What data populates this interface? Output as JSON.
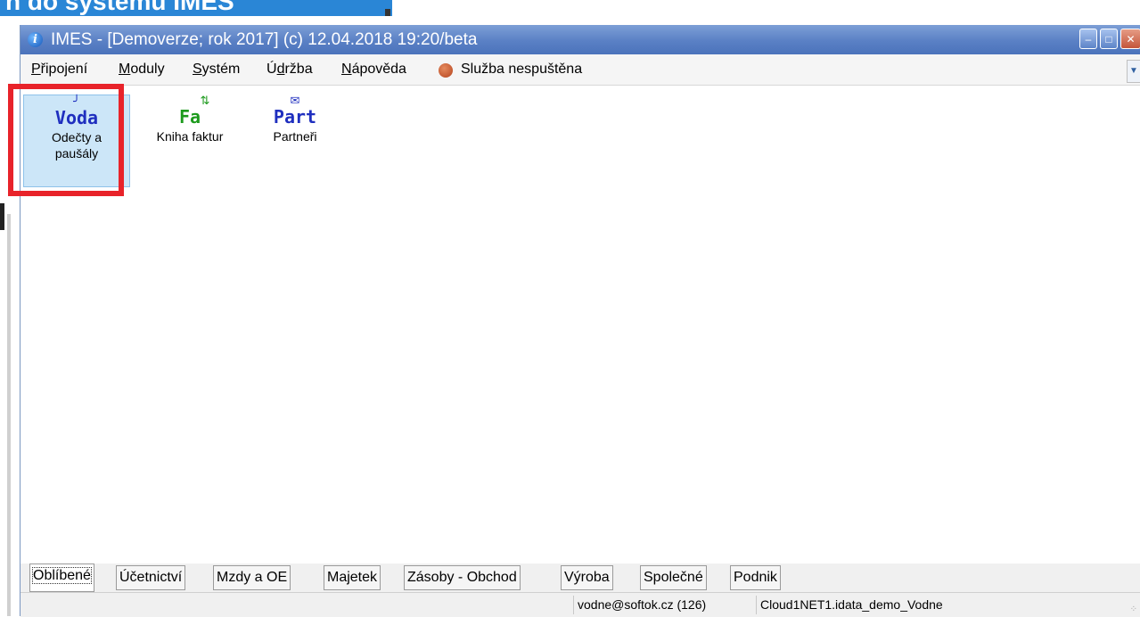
{
  "background": {
    "banner_text": "n do systemu IMES"
  },
  "window": {
    "title": "IMES - [Demoverze;  rok 2017] (c) 12.04.2018 19:20/beta",
    "controls": {
      "minimize": "–",
      "maximize": "□",
      "close": "✕"
    }
  },
  "menu": {
    "items": [
      {
        "pre": "",
        "ul": "P",
        "post": "řipojení"
      },
      {
        "pre": "",
        "ul": "M",
        "post": "oduly"
      },
      {
        "pre": "",
        "ul": "S",
        "post": "ystém"
      },
      {
        "pre": "Ú",
        "ul": "d",
        "post": "ržba"
      },
      {
        "pre": "",
        "ul": "N",
        "post": "ápověda"
      }
    ],
    "service_status": "Služba nespuštěna",
    "service_color": "#c0502a"
  },
  "tiles": [
    {
      "mnemonic": "Voda",
      "label_line1": "Odečty a",
      "label_line2": "paušály",
      "mnemonic_color": "#1f2fbf",
      "icon": "tap-icon",
      "selected": true
    },
    {
      "mnemonic": "Fa",
      "label_line1": "Kniha faktur",
      "label_line2": "",
      "mnemonic_color": "#1c9a1c",
      "icon": "swap-arrows-icon",
      "selected": false
    },
    {
      "mnemonic": "Part",
      "label_line1": "Partneři",
      "label_line2": "",
      "mnemonic_color": "#1f2fbf",
      "icon": "envelope-icon",
      "selected": false
    }
  ],
  "tabs": [
    {
      "label": "Oblíbené",
      "active": true
    },
    {
      "label": "Účetnictví",
      "active": false
    },
    {
      "label": "Mzdy a OE",
      "active": false
    },
    {
      "label": "Majetek",
      "active": false
    },
    {
      "label": "Zásoby - Obchod",
      "active": false
    },
    {
      "label": "Výroba",
      "active": false
    },
    {
      "label": "Společné",
      "active": false
    },
    {
      "label": "Podnik",
      "active": false
    }
  ],
  "status": {
    "user": "vodne@softok.cz (126)",
    "database": "Cloud1NET1.idata_demo_Vodne"
  },
  "colors": {
    "titlebar": "#5a80c5",
    "highlight": "#e8232a",
    "selected_tile": "#cce6f8"
  }
}
